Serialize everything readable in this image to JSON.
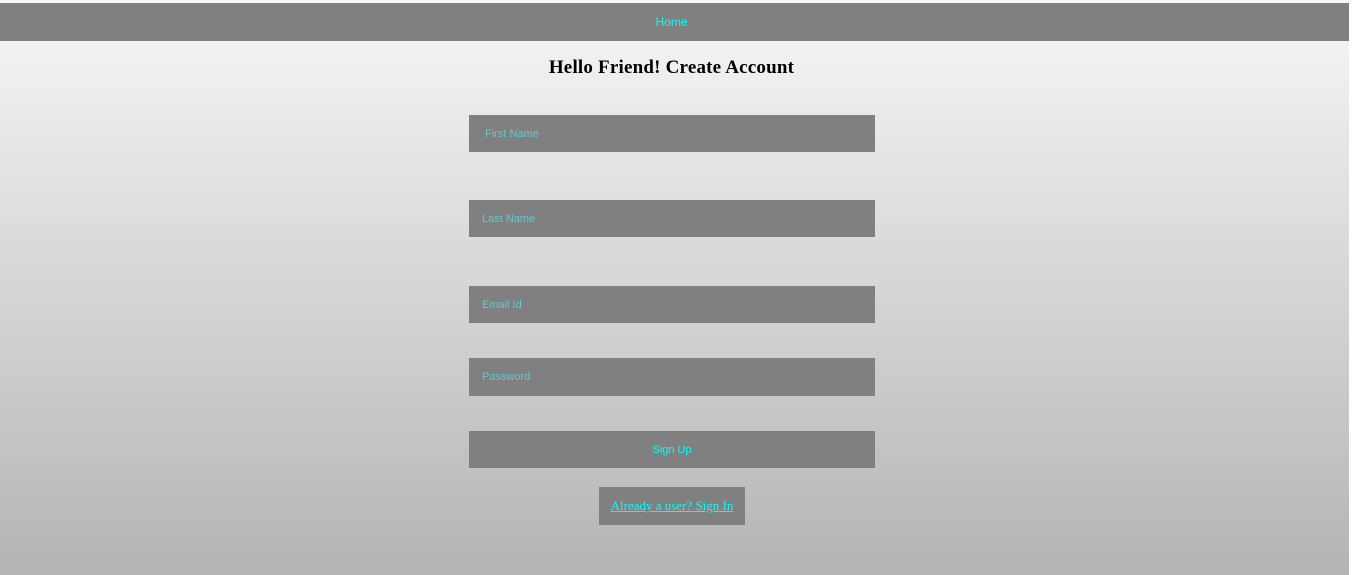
{
  "nav": {
    "home_label": "Home"
  },
  "page": {
    "title": "Hello Friend! Create Account"
  },
  "form": {
    "first_name_placeholder": "First Name",
    "last_name_placeholder": "Last Name",
    "email_placeholder": "Email Id",
    "password_placeholder": "Password",
    "signup_label": "Sign Up",
    "signin_link_label": "Already a user? Sign In"
  },
  "colors": {
    "bar_background": "#808080",
    "link_text": "#00ffff",
    "placeholder_text": "#5fc8d0",
    "gradient_top": "#f7f7f7",
    "gradient_bottom": "#b4b4b4"
  }
}
